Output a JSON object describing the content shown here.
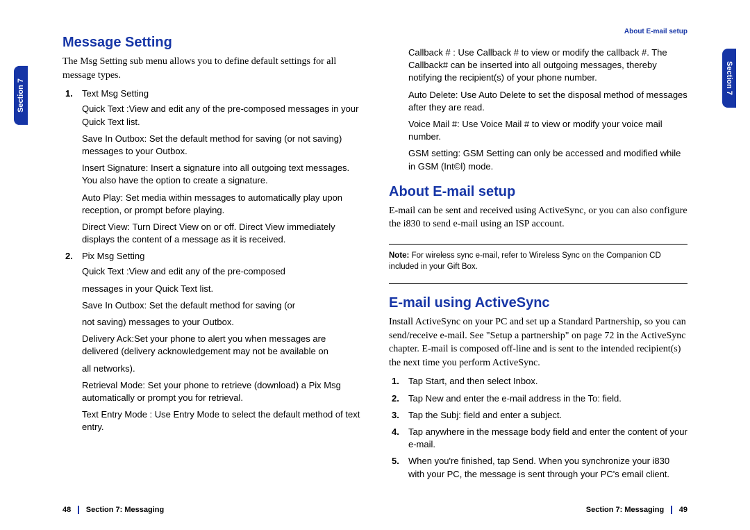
{
  "leftPage": {
    "sectionTab": "Section 7",
    "h1": "Message Setting",
    "intro": "The Msg Setting sub menu allows you to define default settings for all message types.",
    "list": [
      {
        "head": "Text Msg Setting",
        "subs": [
          "Quick Text :View and edit any of the pre-composed messages in your Quick Text list.",
          "Save In Outbox: Set the default method for saving (or not saving) messages to your Outbox.",
          "Insert Signature: Insert a signature into all outgoing text messages. You also have the option to create a signature.",
          "Auto Play: Set media within messages to automatically play upon reception, or prompt before playing.",
          "Direct View: Turn Direct View on or off. Direct View immediately displays the content of a message as it is received."
        ]
      },
      {
        "head": "Pix Msg Setting",
        "subs": [
          "Quick Text :View and edit any of the pre-composed",
          "messages in your Quick Text list.",
          "Save In Outbox: Set the default method for saving (or",
          "not saving) messages to your Outbox.",
          "Delivery Ack:Set your phone to alert you when messages are delivered (delivery acknowledgement may not be available on",
          "all networks).",
          "Retrieval Mode: Set your phone to retrieve (download) a Pix Msg automatically or prompt you for retrieval.",
          "Text Entry Mode : Use Entry Mode to select the default method of text entry."
        ]
      }
    ],
    "footer": {
      "page": "48",
      "section": "Section 7: Messaging"
    }
  },
  "rightPage": {
    "headerRight": "About E-mail setup",
    "sectionTab": "Section 7",
    "continuedSubs": [
      "Callback # : Use Callback # to view or modify the callback #. The Callback# can be inserted into all outgoing messages, thereby notifying the recipient(s) of your phone number.",
      "Auto Delete: Use Auto Delete to set the disposal method of messages after they are read.",
      "Voice Mail #: Use Voice Mail # to view or modify your voice mail number.",
      "GSM setting: GSM Setting can only be accessed and modified while in GSM (Int©l) mode."
    ],
    "h1a": "About E-mail setup",
    "introA": "E-mail can be sent and received using ActiveSync, or you can also configure the i830 to send e-mail using an ISP account.",
    "noteLabel": "Note:",
    "noteBody": "For wireless sync e-mail, refer to Wireless Sync on the Companion CD included in your Gift Box.",
    "h1b": "E-mail using ActiveSync",
    "introB": "Install ActiveSync on your PC and set up a Standard Partnership, so you can send/receive e-mail. See \"Setup a partnership\" on page 72 in the ActiveSync chapter. E-mail is composed off-line and is sent to the intended recipient(s) the next time you perform ActiveSync.",
    "steps": [
      "Tap Start, and then select Inbox.",
      "Tap New and enter the e-mail address in the To: field.",
      "Tap the Subj: field and enter a subject.",
      "Tap anywhere in the message body field and enter the content of your e-mail.",
      "When you're finished, tap Send. When you synchronize your i830 with your PC, the message is sent through your PC's email client."
    ],
    "footer": {
      "section": "Section 7: Messaging",
      "page": "49"
    }
  }
}
